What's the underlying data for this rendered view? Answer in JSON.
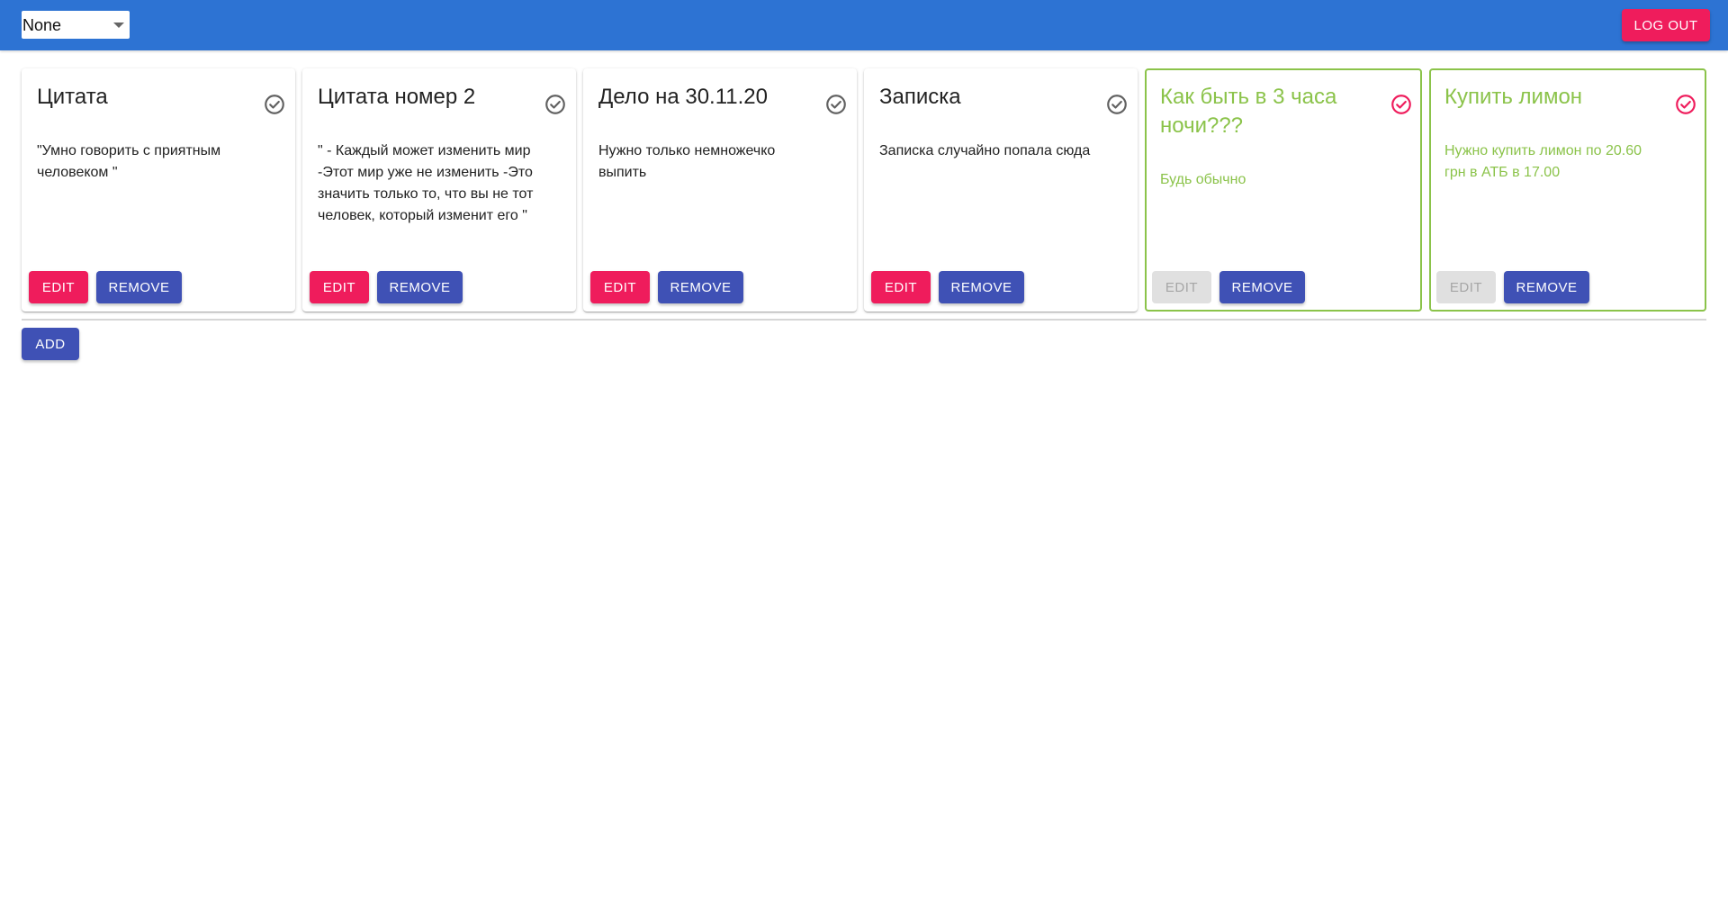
{
  "header": {
    "filter_value": "None",
    "logout_label": "LOG OUT"
  },
  "cards": [
    {
      "title": "Цитата",
      "body": "\"Умно говорить с приятным человеком \"",
      "edit_label": "EDIT",
      "remove_label": "REMOVE",
      "done": false,
      "check_icon": "check-circle-outline-icon"
    },
    {
      "title": "Цитата номер 2",
      "body": "\" - Каждый может изменить мир -Этот мир уже не изменить -Это значить только то, что вы не тот человек, который изменит его \"",
      "edit_label": "EDIT",
      "remove_label": "REMOVE",
      "done": false,
      "check_icon": "check-circle-outline-icon"
    },
    {
      "title": "Дело на 30.11.20",
      "body": "Нужно только немножечко выпить",
      "edit_label": "EDIT",
      "remove_label": "REMOVE",
      "done": false,
      "check_icon": "check-circle-outline-icon"
    },
    {
      "title": "Записка",
      "body": "Записка случайно попала сюда",
      "edit_label": "EDIT",
      "remove_label": "REMOVE",
      "done": false,
      "check_icon": "check-circle-outline-icon"
    },
    {
      "title": "Как быть в 3 часа ночи???",
      "body": "Будь обычно",
      "edit_label": "EDIT",
      "remove_label": "REMOVE",
      "done": true,
      "check_icon": "check-circle-outline-icon"
    },
    {
      "title": "Купить лимон",
      "body": "Нужно купить лимон по 20.60 грн в АТБ в 17.00",
      "edit_label": "EDIT",
      "remove_label": "REMOVE",
      "done": true,
      "check_icon": "check-circle-outline-icon"
    }
  ],
  "add_label": "ADD",
  "colors": {
    "appbar": "#2d73d3",
    "accent_pink": "#ef1c5c",
    "primary_indigo": "#3f51b5",
    "done_green": "#8bc34a",
    "check_gray": "#616161"
  }
}
